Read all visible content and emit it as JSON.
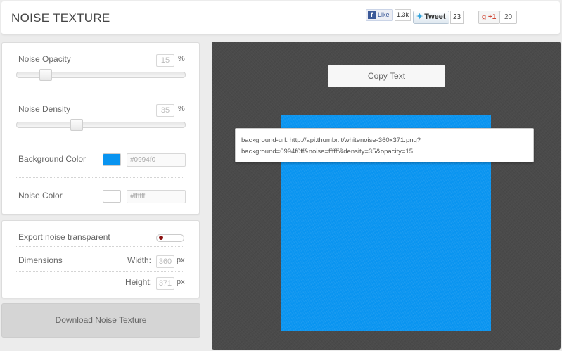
{
  "header": {
    "title": "NOISE TEXTURE",
    "social": {
      "fb_label": "Like",
      "fb_count": "1.3k",
      "tweet_label": "Tweet",
      "tweet_count": "23",
      "gplus_label": "+1",
      "gplus_count": "20"
    }
  },
  "settings": {
    "noise_opacity": {
      "label": "Noise Opacity",
      "value": "15",
      "unit": "%",
      "slider_level": 0.15
    },
    "noise_density": {
      "label": "Noise Density",
      "value": "35",
      "unit": "%",
      "slider_level": 0.35
    },
    "background_color": {
      "label": "Background Color",
      "value": "#0994f0",
      "swatch": "#0994f0"
    },
    "noise_color": {
      "label": "Noise Color",
      "value": "#ffffff",
      "swatch": "#ffffff"
    }
  },
  "export": {
    "transparent_label": "Export noise transparent",
    "dimensions_label": "Dimensions",
    "width_label": "Width:",
    "width_value": "360",
    "width_unit": "px",
    "height_label": "Height:",
    "height_value": "371",
    "height_unit": "px"
  },
  "download_label": "Download Noise Texture",
  "preview": {
    "copy_label": "Copy Text",
    "code_line1": "background-url: http://api.thumbr.it/whitenoise-360x371.png?",
    "code_line2": "background=0994f0ff&noise=ffffff&density=35&opacity=15",
    "texture_color": "#0994f0"
  }
}
